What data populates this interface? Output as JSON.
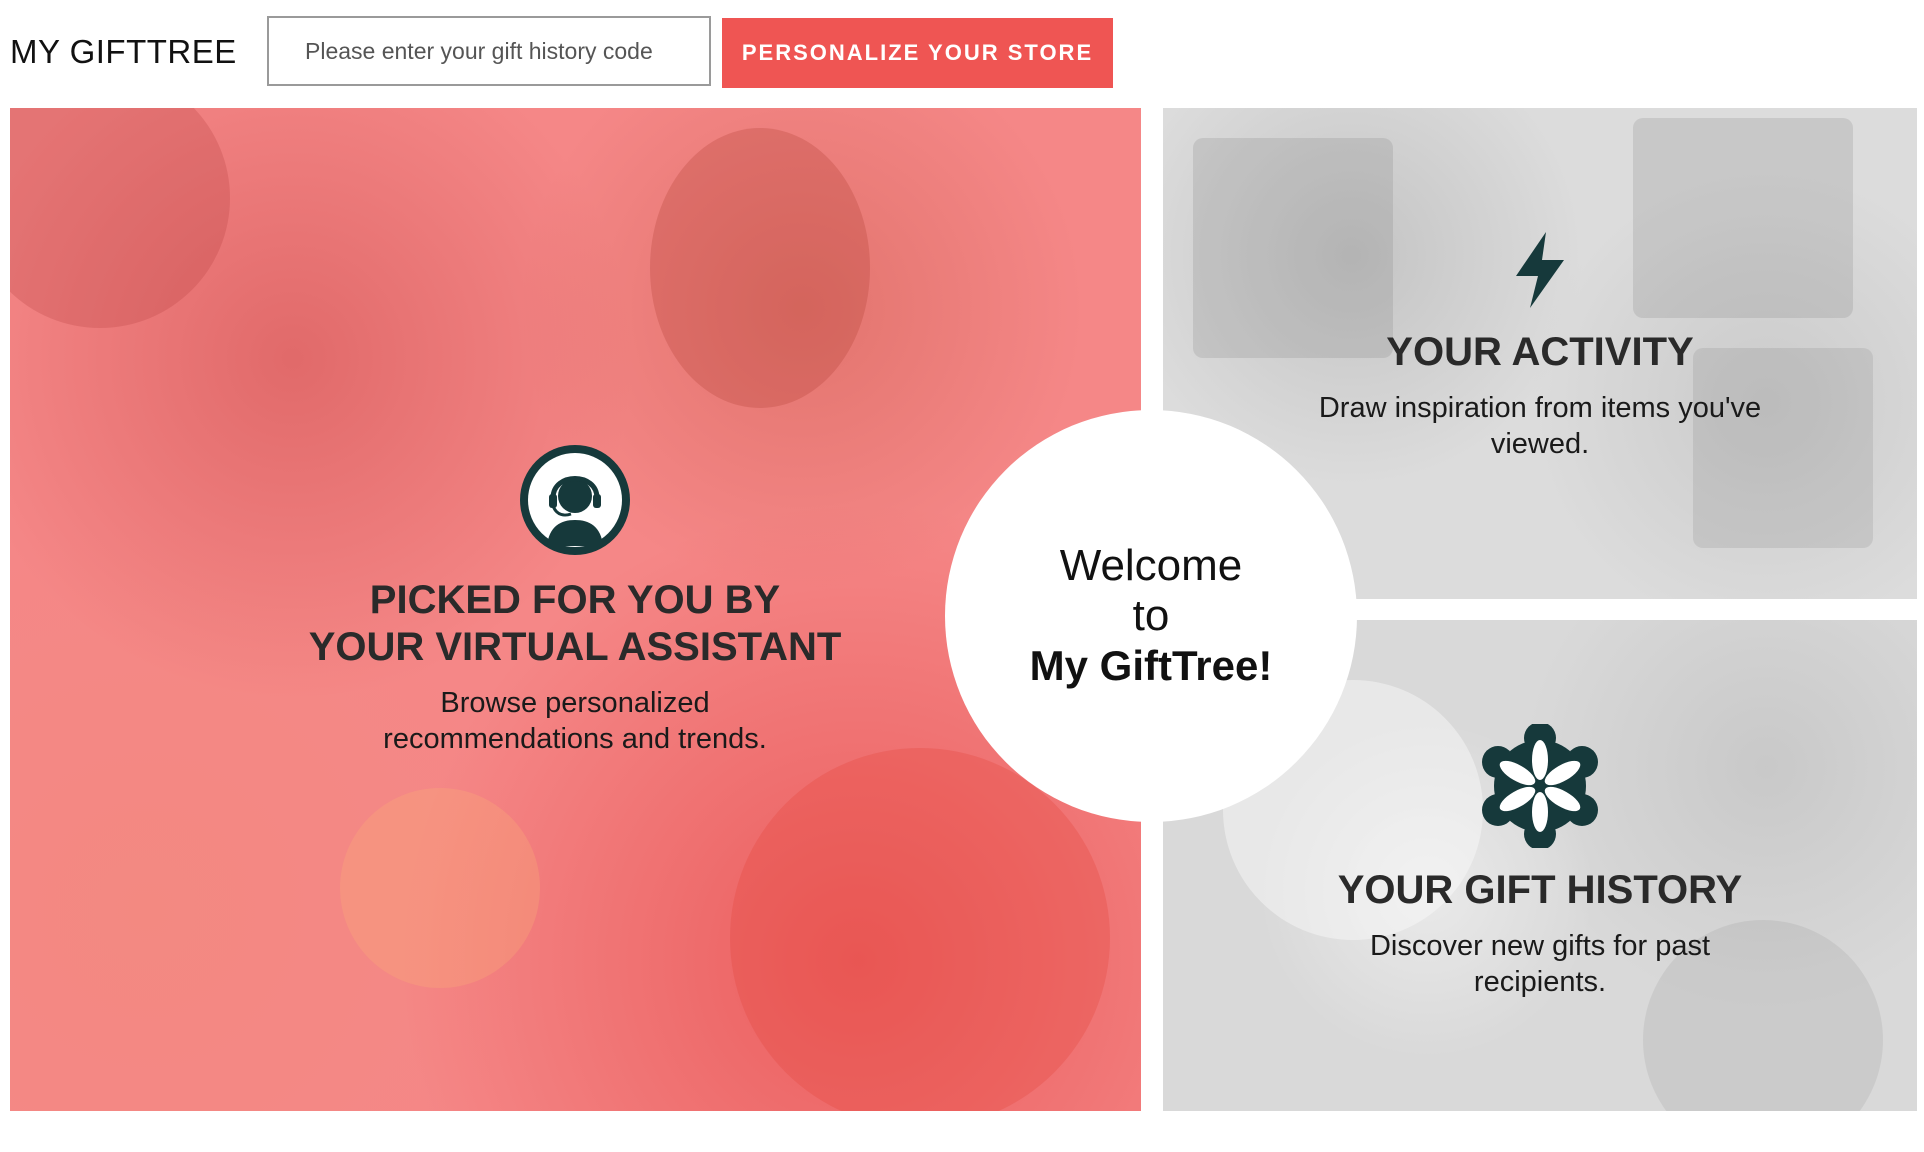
{
  "header": {
    "brand": "MY GIFTTREE",
    "search_placeholder": "Please enter your gift history code",
    "personalize_label": "PERSONALIZE YOUR STORE"
  },
  "panels": [
    {
      "icon": "headset-assistant-icon",
      "title_line1": "PICKED FOR YOU BY",
      "title_line2": "YOUR VIRTUAL ASSISTANT",
      "desc_line1": "Browse personalized",
      "desc_line2": "recommendations and trends."
    },
    {
      "icon": "lightning-bolt-icon",
      "title": "YOUR ACTIVITY",
      "desc_line1": "Draw inspiration from items you've",
      "desc_line2": "viewed."
    },
    {
      "icon": "flower-badge-icon",
      "title": "YOUR GIFT HISTORY",
      "desc_line1": "Discover new gifts for past",
      "desc_line2": "recipients."
    }
  ],
  "welcome": {
    "line1": "Welcome",
    "line2": "to",
    "brand": "My GiftTree!"
  },
  "colors": {
    "accent": "#ef5553",
    "icon_dark": "#16393b",
    "left_panel": "#f58787",
    "right_panel": "#dcdcdc"
  }
}
